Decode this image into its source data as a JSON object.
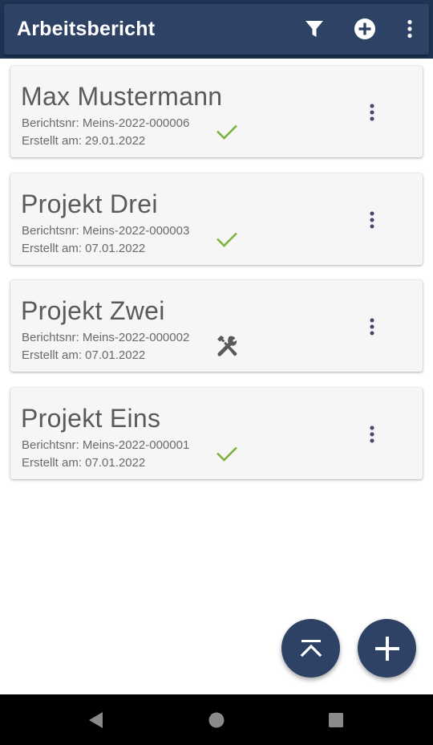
{
  "app_bar": {
    "title": "Arbeitsbericht",
    "actions": [
      {
        "icon": "filter-icon"
      },
      {
        "icon": "add-circle-icon"
      },
      {
        "icon": "more-vert-icon"
      }
    ]
  },
  "reports": [
    {
      "title": "Max Mustermann",
      "report_no_label": "Berichtsnr: Meins-2022-000006",
      "created_label": "Erstellt am: 29.01.2022",
      "status": "completed",
      "status_icon": "check-icon"
    },
    {
      "title": "Projekt Drei",
      "report_no_label": "Berichtsnr: Meins-2022-000003",
      "created_label": "Erstellt am: 07.01.2022",
      "status": "completed",
      "status_icon": "check-icon"
    },
    {
      "title": "Projekt Zwei",
      "report_no_label": "Berichtsnr: Meins-2022-000002",
      "created_label": "Erstellt am: 07.01.2022",
      "status": "in-progress",
      "status_icon": "tools-icon"
    },
    {
      "title": "Projekt Eins",
      "report_no_label": "Berichtsnr: Meins-2022-000001",
      "created_label": "Erstellt am: 07.01.2022",
      "status": "completed",
      "status_icon": "check-icon"
    }
  ],
  "fabs": [
    {
      "icon": "scroll-to-top-icon"
    },
    {
      "icon": "plus-icon"
    }
  ],
  "colors": {
    "primary": "#2e4266",
    "primary_dark": "#1f3354",
    "check_green": "#7cb342",
    "tools_gray": "#5a5a5a"
  }
}
